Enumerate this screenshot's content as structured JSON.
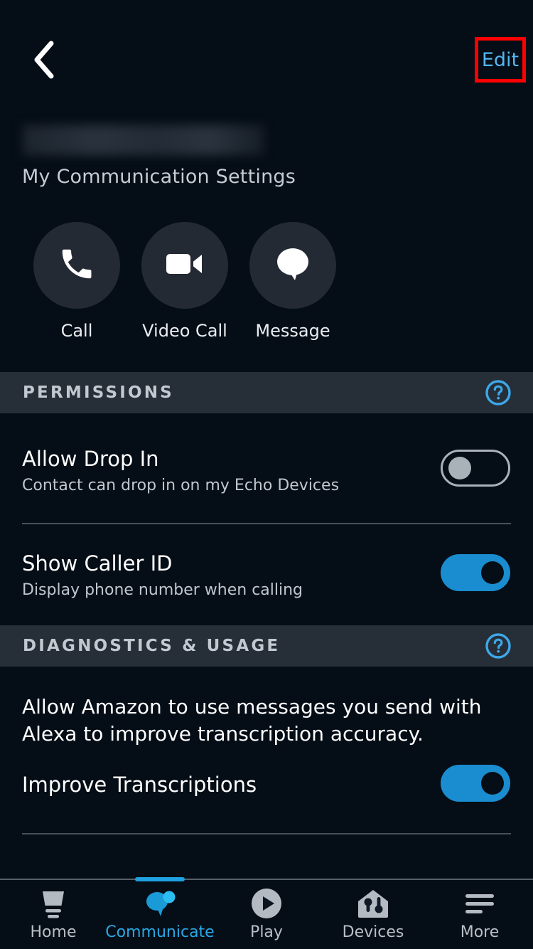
{
  "topbar": {
    "back_icon": "chevron-left-icon",
    "edit_label": "Edit",
    "edit_highlight_color": "#ff0000",
    "accent_color": "#53b7f0"
  },
  "contact": {
    "name": "",
    "name_redacted": true,
    "subtitle": "My Communication Settings"
  },
  "actions": [
    {
      "label": "Call",
      "icon": "phone-icon"
    },
    {
      "label": "Video Call",
      "icon": "video-camera-icon"
    },
    {
      "label": "Message",
      "icon": "speech-bubble-icon"
    }
  ],
  "permissions": {
    "header": "PERMISSIONS",
    "help_icon": "question-mark-circle-icon",
    "rows": [
      {
        "title": "Allow Drop In",
        "description": "Contact can drop in on my Echo Devices",
        "toggle_state": "off"
      },
      {
        "title": "Show Caller ID",
        "description": "Display phone number when calling",
        "toggle_state": "on"
      }
    ]
  },
  "diagnostics": {
    "header": "DIAGNOSTICS & USAGE",
    "help_icon": "question-mark-circle-icon",
    "paragraph": "Allow Amazon to use messages you send with Alexa to improve transcription accuracy.",
    "rows": [
      {
        "title": "Improve Transcriptions",
        "toggle_state": "on"
      }
    ]
  },
  "tabbar": {
    "active": "Communicate",
    "active_color": "#29a8e4",
    "items": [
      {
        "label": "Home",
        "icon": "echo-device-icon"
      },
      {
        "label": "Communicate",
        "icon": "chat-bubbles-icon"
      },
      {
        "label": "Play",
        "icon": "play-circle-icon"
      },
      {
        "label": "Devices",
        "icon": "home-devices-icon"
      },
      {
        "label": "More",
        "icon": "hamburger-menu-icon"
      }
    ]
  },
  "colors": {
    "background": "#050d16",
    "section_header_bg": "#262e38",
    "toggle_on": "#1a8dd0",
    "toggle_off_border": "#a9b1b9",
    "divider": "#48505a"
  }
}
